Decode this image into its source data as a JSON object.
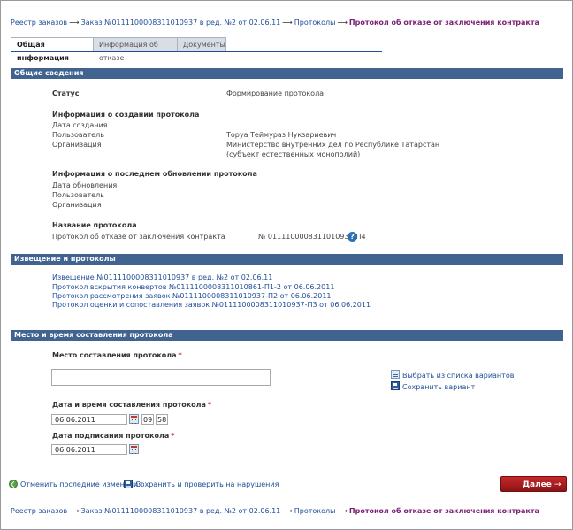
{
  "breadcrumb": {
    "registry": "Реестр заказов",
    "order": "Заказ №0111100008311010937 в ред. №2 от 02.06.11",
    "protocols": "Протоколы",
    "current": "Протокол об отказе от заключения контракта",
    "arrow": "⟶"
  },
  "tabs": [
    "Общая информация",
    "Информация об отказе",
    "Документы"
  ],
  "general": {
    "title": "Общие сведения",
    "status_label": "Статус",
    "status_value": "Формирование протокола",
    "created_heading": "Информация о создании протокола",
    "created_date_label": "Дата создания",
    "created_user_label": "Пользователь",
    "created_user_value": "Торуа Теймураз Нукзариевич",
    "created_org_label": "Организация",
    "created_org_value_1": "Министерство внутренних дел по Республике Татарстан",
    "created_org_value_2": "(субъект естественных монополий)",
    "updated_heading": "Информация о последнем обновлении протокола",
    "updated_date_label": "Дата обновления",
    "updated_user_label": "Пользователь",
    "updated_org_label": "Организация",
    "name_heading": "Название протокола",
    "name_label": "Протокол об отказе от заключения контракта",
    "name_value": "№ 0111100008311010937-П4"
  },
  "notices": {
    "title": "Извещение и протоколы",
    "links": [
      "Извещение №0111100008311010937 в ред. №2 от 02.06.11",
      "Протокол вскрытия конвертов №0111100008311010861-П1-2 от 06.06.2011",
      "Протокол рассмотрения заявок №0111100008311010937-П2 от 06.06.2011",
      "Протокол оценки и сопоставления заявок №0111100008311010937-П3 от 06.06.2011"
    ]
  },
  "place": {
    "title": "Место и время составления протокола",
    "place_label": "Место составления протокола",
    "place_value": "",
    "choose_link": "Выбрать из списка вариантов",
    "save_variant_link": "Сохранить вариант",
    "datetime_label": "Дата и время составления протокола",
    "date_value": "06.06.2011",
    "hour_value": "09",
    "minute_value": "58",
    "sign_label": "Дата подписания протокола",
    "sign_value": "06.06.2011",
    "required_mark": "*"
  },
  "actions": {
    "undo": "Отменить последние изменения",
    "save_check": "Сохранить и проверить на нарушения",
    "next": "Далее",
    "next_arrow": "→"
  },
  "colors": {
    "section_header": "#41638f",
    "link": "#1f4e99",
    "current_crumb": "#7a1f72",
    "next_button": "#b01d20"
  }
}
